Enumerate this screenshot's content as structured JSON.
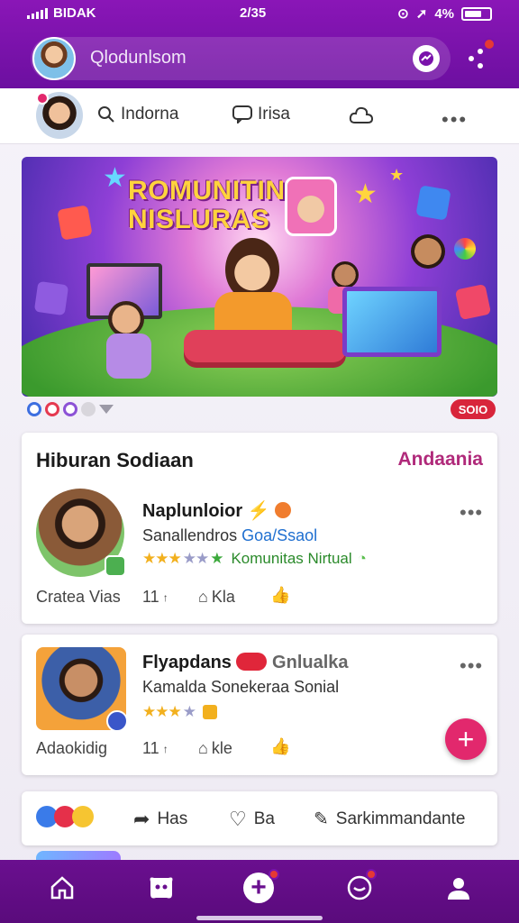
{
  "status_bar": {
    "carrier": "BIDAK",
    "time": "2/35",
    "battery": "4%"
  },
  "header": {
    "search_text": "Qlodunlsom"
  },
  "subnav": {
    "items": [
      {
        "label": "Indorna",
        "icon": "search-icon"
      },
      {
        "label": "Irisa",
        "icon": "chat-icon"
      },
      {
        "label": "",
        "icon": "cloud-icon"
      }
    ]
  },
  "banner": {
    "title_line1": "ROMUNITIN",
    "title_line2": "NISLURAS",
    "badge": "SOIO"
  },
  "section": {
    "title": "Hiburan Sodiaan",
    "link": "Andaania",
    "card1": {
      "name": "Naplunloior",
      "subline_a": "Sanallendros ",
      "subline_b": "Goa/Ssaol",
      "stars": 3,
      "rating_text": "Komunitas Nirtual",
      "meta_left": "Cratea Vias",
      "meta_count": "11",
      "meta_like": "Kla"
    }
  },
  "card2": {
    "name": "Flyapdans",
    "tag": "Gnlualka",
    "subline": "Kamalda Sonekeraa Sonial",
    "stars": 3,
    "meta_left": "Adaokidig",
    "meta_count": "11",
    "meta_like": "kle"
  },
  "reactions": {
    "btn1": "Has",
    "btn2": "Ba",
    "btn3": "Sarkimmandante"
  },
  "colors": {
    "brand": "#7a12ab",
    "accent": "#e2286d",
    "link": "#b0297a"
  }
}
